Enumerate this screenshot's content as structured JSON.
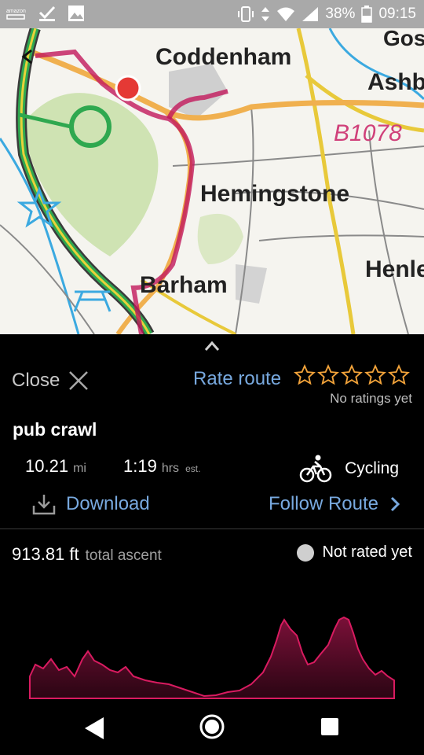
{
  "status_bar": {
    "notification_icons": [
      "amazon-prime-icon",
      "check-icon",
      "image-icon"
    ],
    "system_icons": [
      "vibrate-icon",
      "data-arrows-icon",
      "wifi-icon",
      "signal-icon"
    ],
    "battery": "38%",
    "time": "09:15"
  },
  "map": {
    "place_labels": [
      "Coddenham",
      "Hemingstone",
      "Barham",
      "Gos",
      "Ashb",
      "B1078",
      "Henle"
    ],
    "route_color": "#c2185b",
    "marker_color": "#e53935"
  },
  "panel": {
    "close_label": "Close",
    "rate_label": "Rate route",
    "stars": 5,
    "rating_value": 0,
    "no_ratings_label": "No ratings yet",
    "route_name": "pub crawl",
    "distance": "10.21",
    "distance_unit": "mi",
    "duration": "1:19",
    "duration_unit": "hrs",
    "duration_note": "est.",
    "mode": "Cycling",
    "download_label": "Download",
    "follow_label": "Follow Route",
    "ascent_value": "913.81 ft",
    "ascent_label": "total ascent",
    "rating_status": "Not rated yet",
    "accent_color": "#78a9df",
    "star_color": "#f2a33a"
  },
  "profile": {
    "series_color": "#c2185b"
  },
  "nav": [
    "back-icon",
    "home-icon",
    "recents-icon"
  ]
}
